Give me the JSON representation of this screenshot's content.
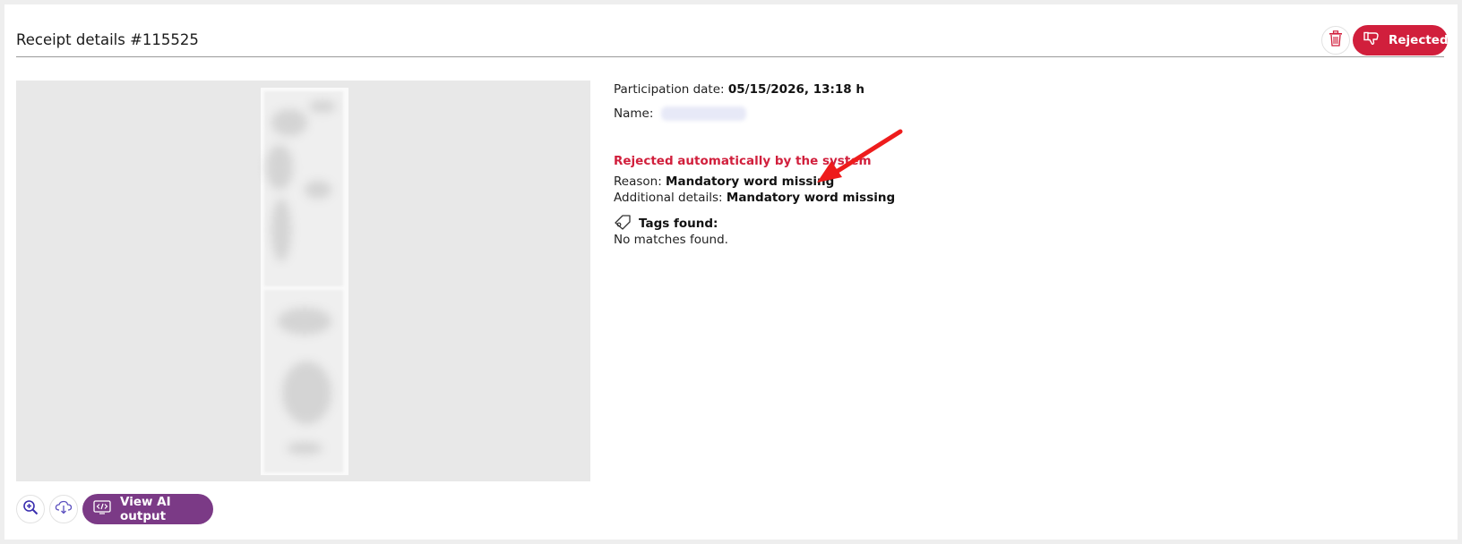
{
  "header": {
    "title": "Receipt details #115525",
    "status_label": "Rejected",
    "delete_icon": "trash-icon",
    "status_icon": "thumbs-down-icon"
  },
  "details": {
    "participation_label": "Participation date:",
    "participation_value": "05/15/2026, 13:18 h",
    "name_label": "Name:",
    "rejection_note": "Rejected automatically by the system",
    "reason_label": "Reason:",
    "reason_value": "Mandatory word missing",
    "additional_label": "Additional details:",
    "additional_value": "Mandatory word missing",
    "tags_label": "Tags found:",
    "tags_value": "No matches found."
  },
  "tools": {
    "zoom_icon": "zoom-in-icon",
    "download_icon": "cloud-download-icon",
    "ai_label": "View AI output",
    "ai_icon": "code-screen-icon"
  },
  "colors": {
    "status_red": "#d11f3c",
    "ai_purple": "#7b3a86",
    "annotation_arrow": "#ee1c1c"
  }
}
